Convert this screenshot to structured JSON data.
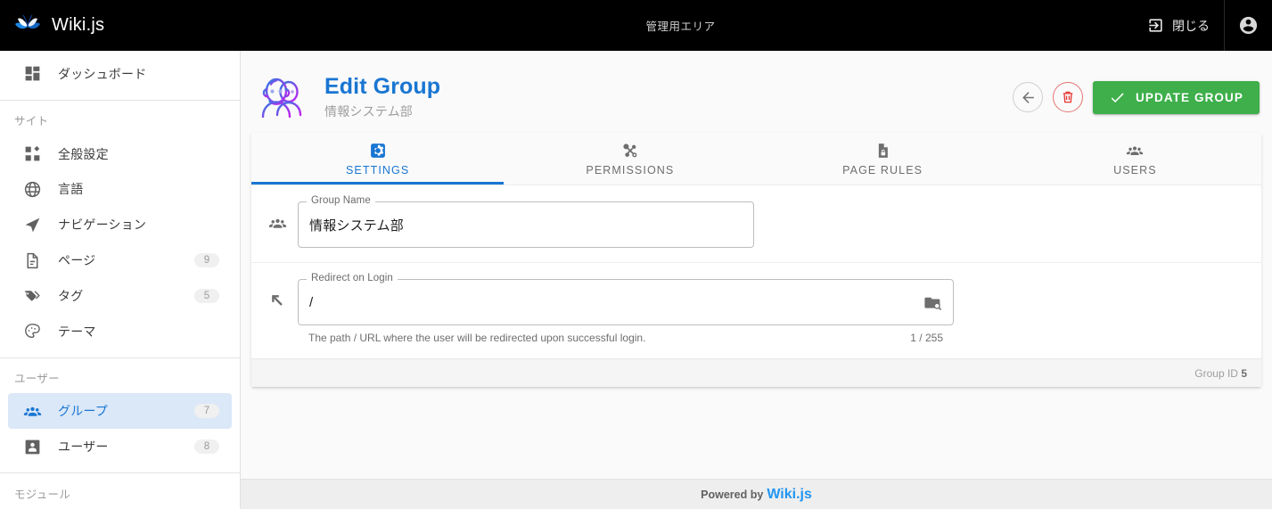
{
  "topbar": {
    "brand": "Wiki.js",
    "brand_logo_icon": "wikijs-butterfly-logo",
    "admin_area_label": "管理用エリア",
    "close_label": "閉じる",
    "close_icon": "exit-to-app-icon",
    "account_icon": "account-circle-icon"
  },
  "sidebar": {
    "items": [
      {
        "label": "ダッシュボード",
        "icon": "dashboard-icon",
        "badge": null,
        "active": false,
        "type": "item"
      },
      {
        "type": "divider"
      },
      {
        "label": "サイト",
        "type": "subheader"
      },
      {
        "label": "全般設定",
        "icon": "view-dashboard-icon",
        "badge": null,
        "active": false,
        "type": "item"
      },
      {
        "label": "言語",
        "icon": "globe-icon",
        "badge": null,
        "active": false,
        "type": "item"
      },
      {
        "label": "ナビゲーション",
        "icon": "navigation-arrow-icon",
        "badge": null,
        "active": false,
        "type": "item"
      },
      {
        "label": "ページ",
        "icon": "file-document-icon",
        "badge": "9",
        "active": false,
        "type": "item"
      },
      {
        "label": "タグ",
        "icon": "tag-multiple-icon",
        "badge": "5",
        "active": false,
        "type": "item"
      },
      {
        "label": "テーマ",
        "icon": "palette-icon",
        "badge": null,
        "active": false,
        "type": "item"
      },
      {
        "type": "divider"
      },
      {
        "label": "ユーザー",
        "type": "subheader"
      },
      {
        "label": "グループ",
        "icon": "account-group-icon",
        "badge": "7",
        "active": true,
        "type": "item"
      },
      {
        "label": "ユーザー",
        "icon": "account-box-icon",
        "badge": "8",
        "active": false,
        "type": "item"
      },
      {
        "type": "divider"
      },
      {
        "label": "モジュール",
        "type": "subheader"
      }
    ]
  },
  "page": {
    "header_icon": "group-people-illustration",
    "title": "Edit Group",
    "subtitle": "情報システム部",
    "actions": {
      "back_icon": "arrow-left-icon",
      "delete_icon": "trash-can-icon",
      "update_icon": "check-icon",
      "update_label": "UPDATE GROUP"
    }
  },
  "tabs": [
    {
      "label": "SETTINGS",
      "icon": "cog-box-icon",
      "active": true
    },
    {
      "label": "PERMISSIONS",
      "icon": "shuffle-variant-icon",
      "active": false
    },
    {
      "label": "PAGE RULES",
      "icon": "file-lock-icon",
      "active": false
    },
    {
      "label": "USERS",
      "icon": "account-group-icon",
      "active": false
    }
  ],
  "settings": {
    "group_name": {
      "icon": "account-group-icon",
      "label": "Group Name",
      "value": "情報システム部"
    },
    "redirect_on_login": {
      "icon": "arrow-top-left-icon",
      "label": "Redirect on Login",
      "value": "/",
      "append_icon": "folder-search-icon",
      "hint": "The path / URL where the user will be redirected upon successful login.",
      "counter": "1 / 255"
    },
    "group_id_label": "Group ID",
    "group_id_value": "5"
  },
  "footer": {
    "powered_by": "Powered by",
    "link": "Wiki.js"
  },
  "colors": {
    "accent_blue": "#1976d2",
    "link_blue": "#2196f3",
    "success_green": "#3eaf4a",
    "danger_red": "#e53935",
    "topbar_black": "#000000",
    "page_bg": "#fafafa",
    "active_nav_bg": "#dbe8f8"
  }
}
